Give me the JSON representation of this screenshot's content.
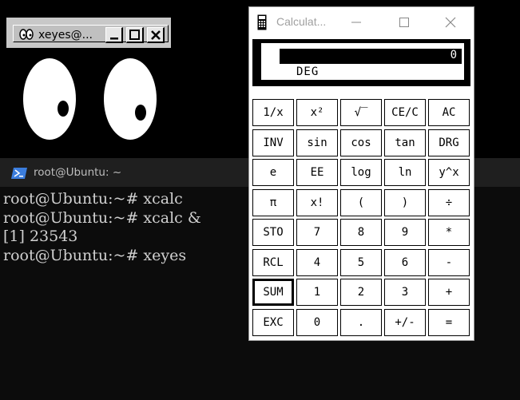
{
  "xeyes": {
    "title": "xeyes@...",
    "icon": "xeyes-icon",
    "buttons": [
      "minimize",
      "maximize",
      "close"
    ]
  },
  "terminal": {
    "title": "root@Ubuntu: ~",
    "icon": "powershell-icon",
    "lines": [
      {
        "prompt": "root@Ubuntu:",
        "tilde": "~",
        "cmd": "# xcalc"
      },
      {
        "prompt": "root@Ubuntu:",
        "tilde": "~",
        "cmd": "# xcalc &"
      },
      {
        "text": "[1] 23543"
      },
      {
        "prompt": "root@Ubuntu:",
        "tilde": "~",
        "cmd": "# xeyes"
      }
    ],
    "bg_color": "#0c0c0c",
    "text_color": "#d0d0d0"
  },
  "calculator": {
    "title": "Calculat...",
    "display": {
      "value": "0",
      "mode": "DEG"
    },
    "rows": [
      [
        "1/x",
        "x²",
        "√‾",
        "CE/C",
        "AC"
      ],
      [
        "INV",
        "sin",
        "cos",
        "tan",
        "DRG"
      ],
      [
        "e",
        "EE",
        "log",
        "ln",
        "y^x"
      ],
      [
        "π",
        "x!",
        "(",
        ")",
        "÷"
      ],
      [
        "STO",
        "7",
        "8",
        "9",
        "*"
      ],
      [
        "RCL",
        "4",
        "5",
        "6",
        "-"
      ],
      [
        "SUM",
        "1",
        "2",
        "3",
        "+"
      ],
      [
        "EXC",
        "0",
        ".",
        "+/-",
        "="
      ]
    ],
    "active_key": "SUM"
  }
}
